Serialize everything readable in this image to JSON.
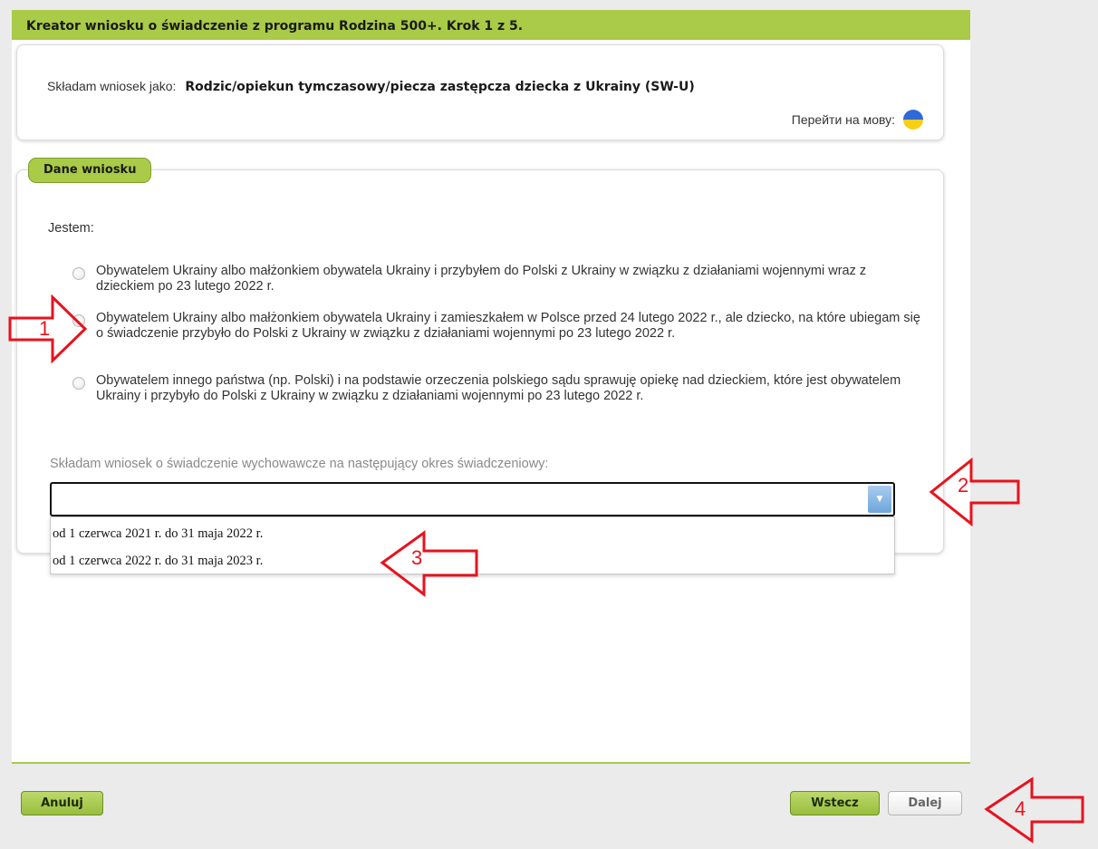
{
  "header": {
    "title": "Kreator wniosku o świadczenie z programu Rodzina 500+. Krok 1 z 5."
  },
  "applicant": {
    "label": "Składam wniosek jako:",
    "value": "Rodzic/opiekun tymczasowy/piecza zastępcza dziecka z Ukrainy (SW-U)"
  },
  "language_switch": {
    "label": "Перейти на мову:",
    "icon": "ukraine-flag-icon"
  },
  "section": {
    "title": "Dane wniosku",
    "intro": "Jestem:",
    "options": [
      {
        "label": "Obywatelem Ukrainy albo małżonkiem obywatela Ukrainy i przybyłem do Polski z Ukrainy w związku z działaniami wojennymi wraz z dzieckiem po 23 lutego 2022 r.",
        "selected": false
      },
      {
        "label": "Obywatelem Ukrainy albo małżonkiem obywatela Ukrainy i zamieszkałem w Polsce przed 24 lutego 2022 r., ale dziecko, na które ubiegam się o świadczenie przybyło do Polski z Ukrainy w związku z działaniami wojennymi po 23 lutego 2022 r.",
        "selected": false
      },
      {
        "label": "Obywatelem innego państwa (np. Polski) i na podstawie orzeczenia polskiego sądu sprawuję opiekę nad dzieckiem, które jest obywatelem Ukrainy i przybyło do Polski z Ukrainy w związku z działaniami wojennymi po 23 lutego 2022 r.",
        "selected": false
      }
    ],
    "period_label": "Składam wniosek o świadczenie wychowawcze na następujący okres świadczeniowy:",
    "period_select": {
      "value": "",
      "options": [
        "od 1 czerwca 2021 r. do 31 maja 2022 r.",
        "od 1 czerwca 2022 r. do 31 maja 2023 r."
      ]
    }
  },
  "buttons": {
    "cancel": "Anuluj",
    "back": "Wstecz",
    "next": "Dalej"
  },
  "annotations": [
    {
      "label": "1",
      "direction": "right"
    },
    {
      "label": "2",
      "direction": "left"
    },
    {
      "label": "3",
      "direction": "left"
    },
    {
      "label": "4",
      "direction": "left"
    }
  ],
  "colors": {
    "header": "#a9cb48",
    "annotation": "#e8121d",
    "page_bg": "#ebebeb"
  }
}
